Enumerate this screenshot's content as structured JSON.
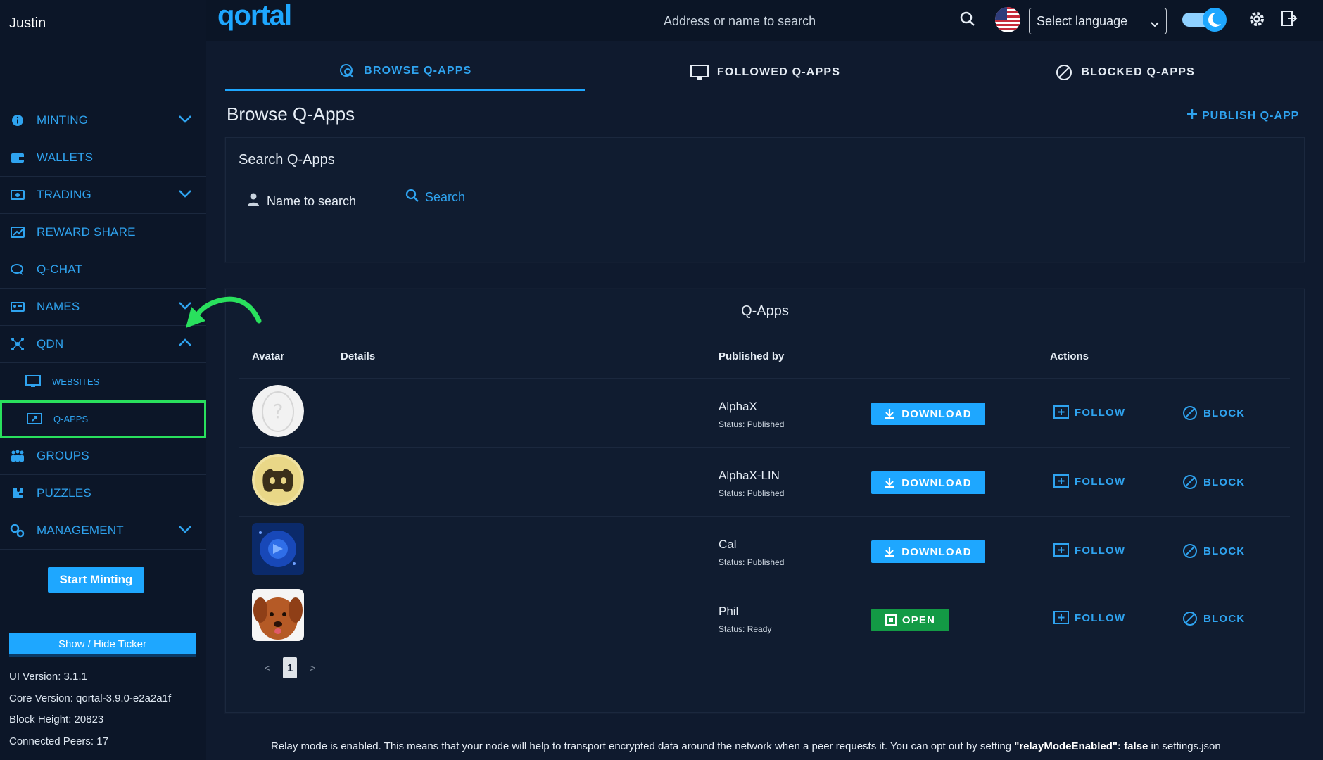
{
  "user": {
    "name": "Justin"
  },
  "topbar": {
    "logo": "qortal",
    "search_placeholder": "Address or name to search",
    "language_label": "Select language"
  },
  "sidebar": {
    "items": [
      {
        "label": "MINTING",
        "icon": "info-icon",
        "chevron": "down"
      },
      {
        "label": "WALLETS",
        "icon": "wallet-icon"
      },
      {
        "label": "TRADING",
        "icon": "trading-icon",
        "chevron": "down"
      },
      {
        "label": "REWARD SHARE",
        "icon": "reward-share-icon"
      },
      {
        "label": "Q-CHAT",
        "icon": "chat-icon"
      },
      {
        "label": "NAMES",
        "icon": "names-icon",
        "chevron": "down"
      },
      {
        "label": "QDN",
        "icon": "network-icon",
        "chevron": "up"
      },
      {
        "label": "WEBSITES",
        "icon": "monitor-icon",
        "sub": true
      },
      {
        "label": "Q-APPS",
        "icon": "app-icon",
        "sub": true,
        "active": true
      },
      {
        "label": "GROUPS",
        "icon": "groups-icon"
      },
      {
        "label": "PUZZLES",
        "icon": "puzzle-icon"
      },
      {
        "label": "MANAGEMENT",
        "icon": "management-icon",
        "chevron": "down"
      }
    ],
    "start_minting": "Start Minting",
    "ticker_button": "Show / Hide Ticker",
    "info": {
      "ui_version": "UI Version: 3.1.1",
      "core_version": "Core Version: qortal-3.9.0-e2a2a1f",
      "block_height": "Block Height: 20823",
      "peers": "Connected Peers: 17"
    }
  },
  "tabs": [
    {
      "label": "BROWSE Q-APPS",
      "icon": "browse-icon",
      "active": true
    },
    {
      "label": "FOLLOWED Q-APPS",
      "icon": "monitor-icon"
    },
    {
      "label": "BLOCKED Q-APPS",
      "icon": "block-icon"
    }
  ],
  "main": {
    "title": "Browse Q-Apps",
    "publish": "PUBLISH Q-APP",
    "search_card": {
      "title": "Search Q-Apps",
      "name_placeholder": "Name to search",
      "search_label": "Search"
    },
    "apps": {
      "title": "Q-Apps",
      "headers": {
        "avatar": "Avatar",
        "details": "Details",
        "published_by": "Published by",
        "actions": "Actions"
      },
      "rows": [
        {
          "name": "AlphaX",
          "status": "Status: Published",
          "action": "DOWNLOAD",
          "avatar": "placeholder"
        },
        {
          "name": "AlphaX-LIN",
          "status": "Status: Published",
          "action": "DOWNLOAD",
          "avatar": "discord"
        },
        {
          "name": "Cal",
          "status": "Status: Published",
          "action": "DOWNLOAD",
          "avatar": "blue"
        },
        {
          "name": "Phil",
          "status": "Status: Ready",
          "action": "OPEN",
          "avatar": "dog"
        }
      ],
      "follow_label": "FOLLOW",
      "block_label": "BLOCK",
      "pager": {
        "prev": "<",
        "page": "1",
        "next": ">"
      }
    },
    "footer": {
      "text_pre": "Relay mode is enabled. This means that your node will help to transport encrypted data around the network when a peer requests it. You can opt out by setting ",
      "text_bold": "\"relayModeEnabled\": false",
      "text_post": " in settings.json"
    }
  },
  "colors": {
    "accent": "#1ea7ff",
    "open_green": "#139a45",
    "highlight_green": "#29e05d",
    "bg": "#0f1a2e"
  }
}
